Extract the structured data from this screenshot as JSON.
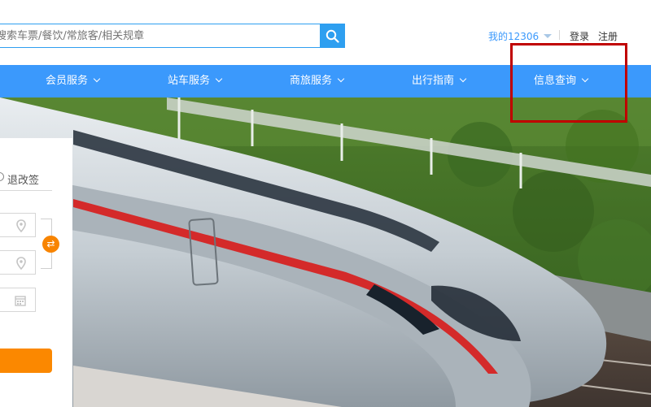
{
  "header": {
    "search": {
      "placeholder": "搜索车票/餐饮/常旅客/相关规章",
      "value": ""
    },
    "search_button_icon": "search-icon",
    "user": {
      "my_account": "我的12306",
      "login": "登录",
      "register": "注册"
    }
  },
  "nav": {
    "items": [
      {
        "label": "会员服务"
      },
      {
        "label": "站车服务"
      },
      {
        "label": "商旅服务"
      },
      {
        "label": "出行指南"
      },
      {
        "label": "信息查询"
      }
    ]
  },
  "booking": {
    "tab_label": "退改签",
    "from_icon": "location-pin-icon",
    "to_icon": "location-pin-icon",
    "date_icon": "calendar-icon",
    "swap_icon": "swap-arrows-icon"
  },
  "colors": {
    "nav_bg": "#3b99fc",
    "search_btn": "#2e9ff0",
    "accent_orange": "#fb8800",
    "highlight": "#c00000"
  }
}
